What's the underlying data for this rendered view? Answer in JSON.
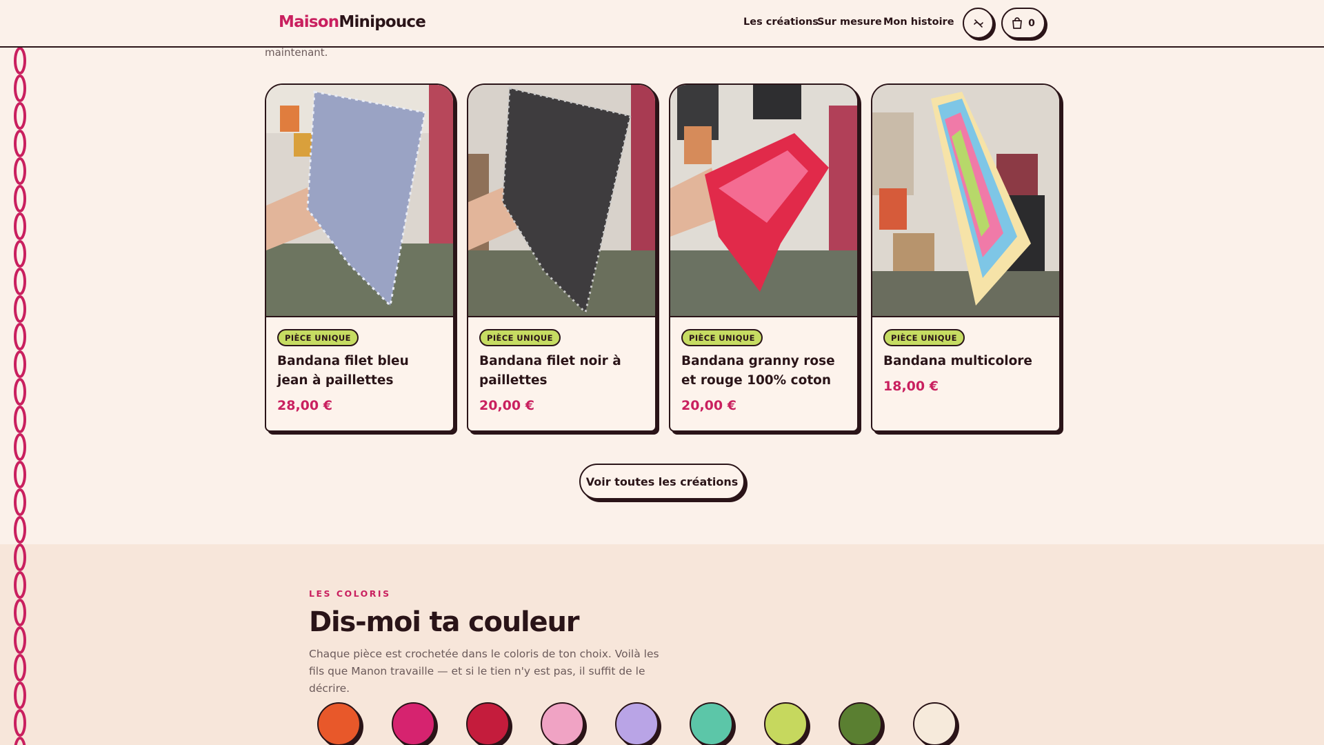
{
  "brand": {
    "part1": "Maison",
    "part2": "Minipouce"
  },
  "nav": [
    "Les créations",
    "Sur mesure",
    "Mon histoire"
  ],
  "cart": {
    "count": "0",
    "icon": "shopping-bag-icon"
  },
  "accessibility_icon": "motion-off-icon",
  "intro_tail": "maintenant.",
  "products": [
    {
      "badge": "PIÈCE UNIQUE",
      "title": "Bandana filet bleu jean à paillettes",
      "price": "28,00 €"
    },
    {
      "badge": "PIÈCE UNIQUE",
      "title": "Bandana filet noir à paillettes",
      "price": "20,00 €"
    },
    {
      "badge": "PIÈCE UNIQUE",
      "title": "Bandana granny rose et rouge 100% coton",
      "price": "20,00 €"
    },
    {
      "badge": "PIÈCE UNIQUE",
      "title": "Bandana multicolore",
      "price": "18,00 €"
    }
  ],
  "cta": "Voir toutes les créations",
  "colors_section": {
    "eyebrow": "LES COLORIS",
    "title": "Dis-moi ta couleur",
    "description": "Chaque pièce est crochetée dans le coloris de ton choix. Voilà les fils que Manon travaille — et si le tien n'y est pas, il suffit de le décrire.",
    "swatches": [
      "#e8582a",
      "#d6236f",
      "#c41c3c",
      "#f0a3c4",
      "#b9a4e6",
      "#5cc6a8",
      "#c6d85e",
      "#5a7f31",
      "#f6eadb"
    ]
  },
  "theme": {
    "accent": "#c9205f",
    "ink": "#2a1418",
    "background": "#fbf1ea",
    "badge": "#c6dc62"
  }
}
